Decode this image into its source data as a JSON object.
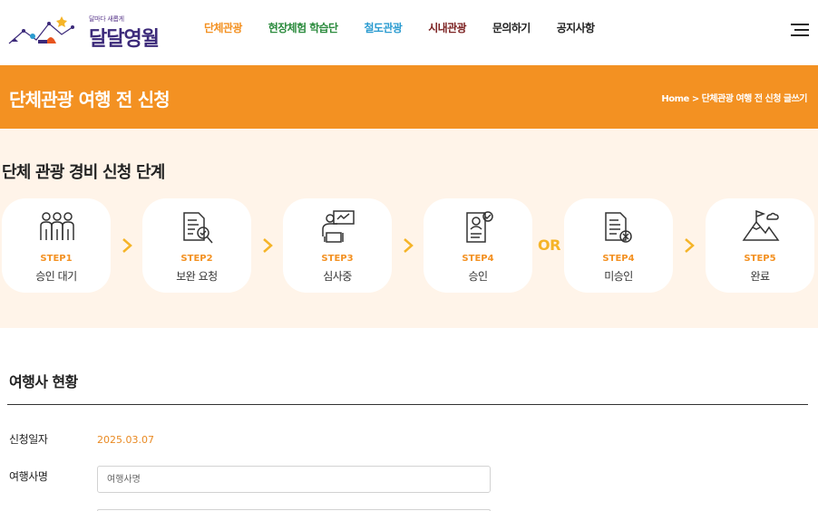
{
  "logo": {
    "tagline": "달마다 새롭게",
    "name": "달달영월"
  },
  "nav": {
    "items": [
      {
        "label": "단체관광",
        "color": "#f39122"
      },
      {
        "label": "현장체험 학습단",
        "color": "#2a8a3c"
      },
      {
        "label": "철도관광",
        "color": "#2a9bd0"
      },
      {
        "label": "시내관광",
        "color": "#7a1f1f"
      },
      {
        "label": "문의하기",
        "color": "#222222"
      },
      {
        "label": "공지사항",
        "color": "#222222"
      }
    ],
    "menu_icon": "hamburger-menu-icon"
  },
  "banner": {
    "title": "단체관광 여행 전 신청",
    "breadcrumb": "Home > 단체관광 여행 전 신청 글쓰기",
    "color": "#f39122"
  },
  "steps": {
    "title": "단체 관광 경비 신청 단계",
    "or_label": "OR",
    "items": [
      {
        "num": "STEP1",
        "label": "승인 대기",
        "icon": "people-group-icon"
      },
      {
        "num": "STEP2",
        "label": "보완 요청",
        "icon": "document-search-icon"
      },
      {
        "num": "STEP3",
        "label": "심사중",
        "icon": "reviewer-board-icon"
      },
      {
        "num": "STEP4",
        "label": "승인",
        "icon": "document-approved-icon"
      },
      {
        "num": "STEP4",
        "label": "미승인",
        "icon": "document-rejected-icon"
      },
      {
        "num": "STEP5",
        "label": "완료",
        "icon": "mountain-flag-icon"
      }
    ]
  },
  "form": {
    "title": "여행사 현황",
    "date_label": "신청일자",
    "date_value": "2025.03.07",
    "agency_label": "여행사명",
    "agency_placeholder": "여행사명"
  }
}
